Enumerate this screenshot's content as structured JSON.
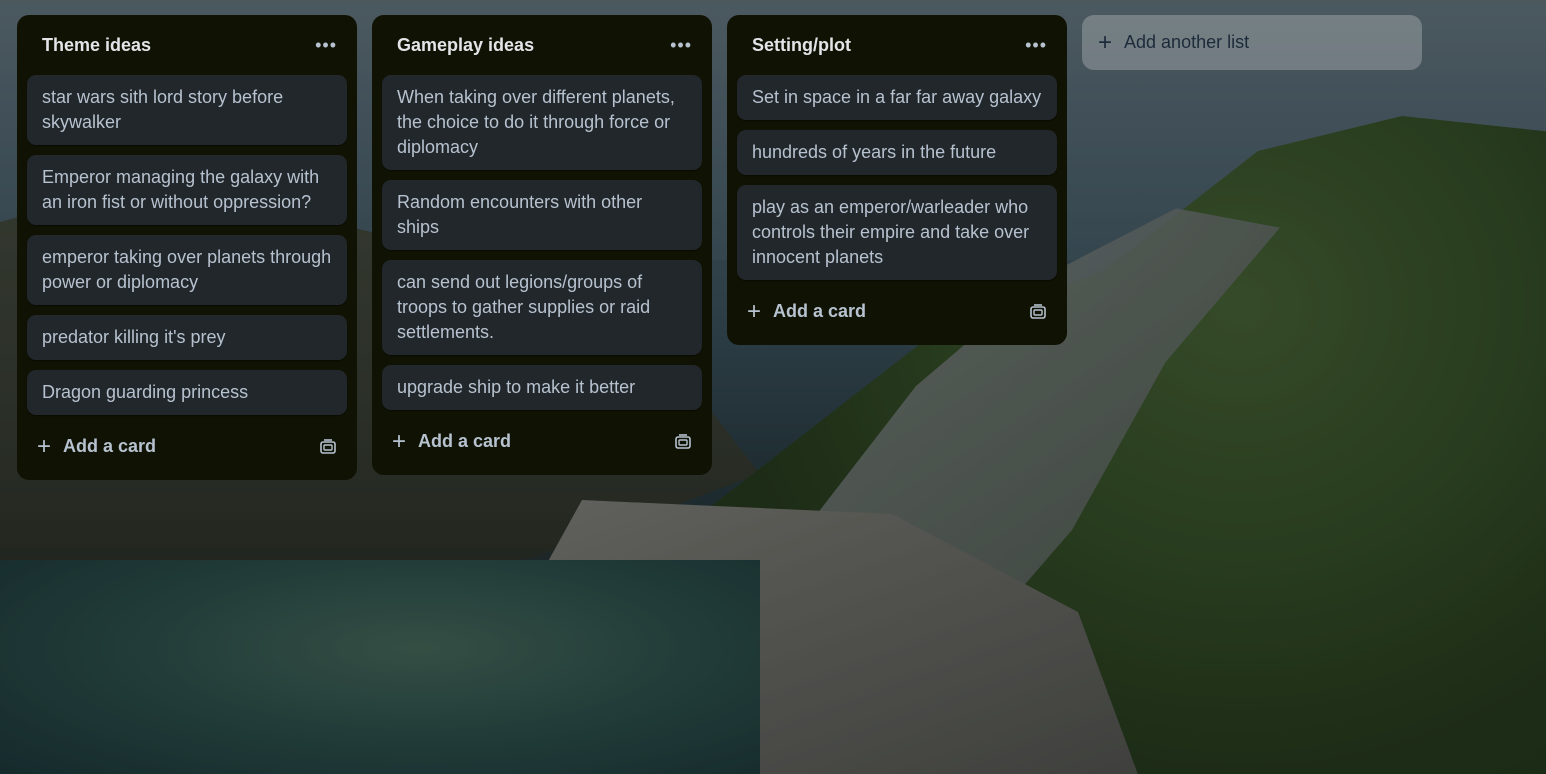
{
  "board": {
    "lists": [
      {
        "title": "Theme ideas",
        "cards": [
          "star wars sith lord story before skywalker",
          "Emperor managing the galaxy with an iron fist or without oppression?",
          "emperor taking over planets through power or diplomacy",
          "predator killing it's prey",
          "Dragon guarding princess"
        ],
        "add_card_label": "Add a card"
      },
      {
        "title": "Gameplay ideas",
        "cards": [
          "When taking over different planets, the choice to do it through force or diplomacy",
          "Random encounters with other ships",
          "can send out legions/groups of troops to gather supplies or raid settlements.",
          "upgrade ship to make it better"
        ],
        "add_card_label": "Add a card"
      },
      {
        "title": "Setting/plot",
        "cards": [
          "Set in space in a far far away galaxy",
          "hundreds of years in the future",
          "play as an emperor/warleader who controls their empire and take over innocent planets"
        ],
        "add_card_label": "Add a card"
      }
    ],
    "add_list_label": "Add another list",
    "list_menu_icon": "more-horizontal-icon",
    "template_icon": "card-template-icon"
  }
}
